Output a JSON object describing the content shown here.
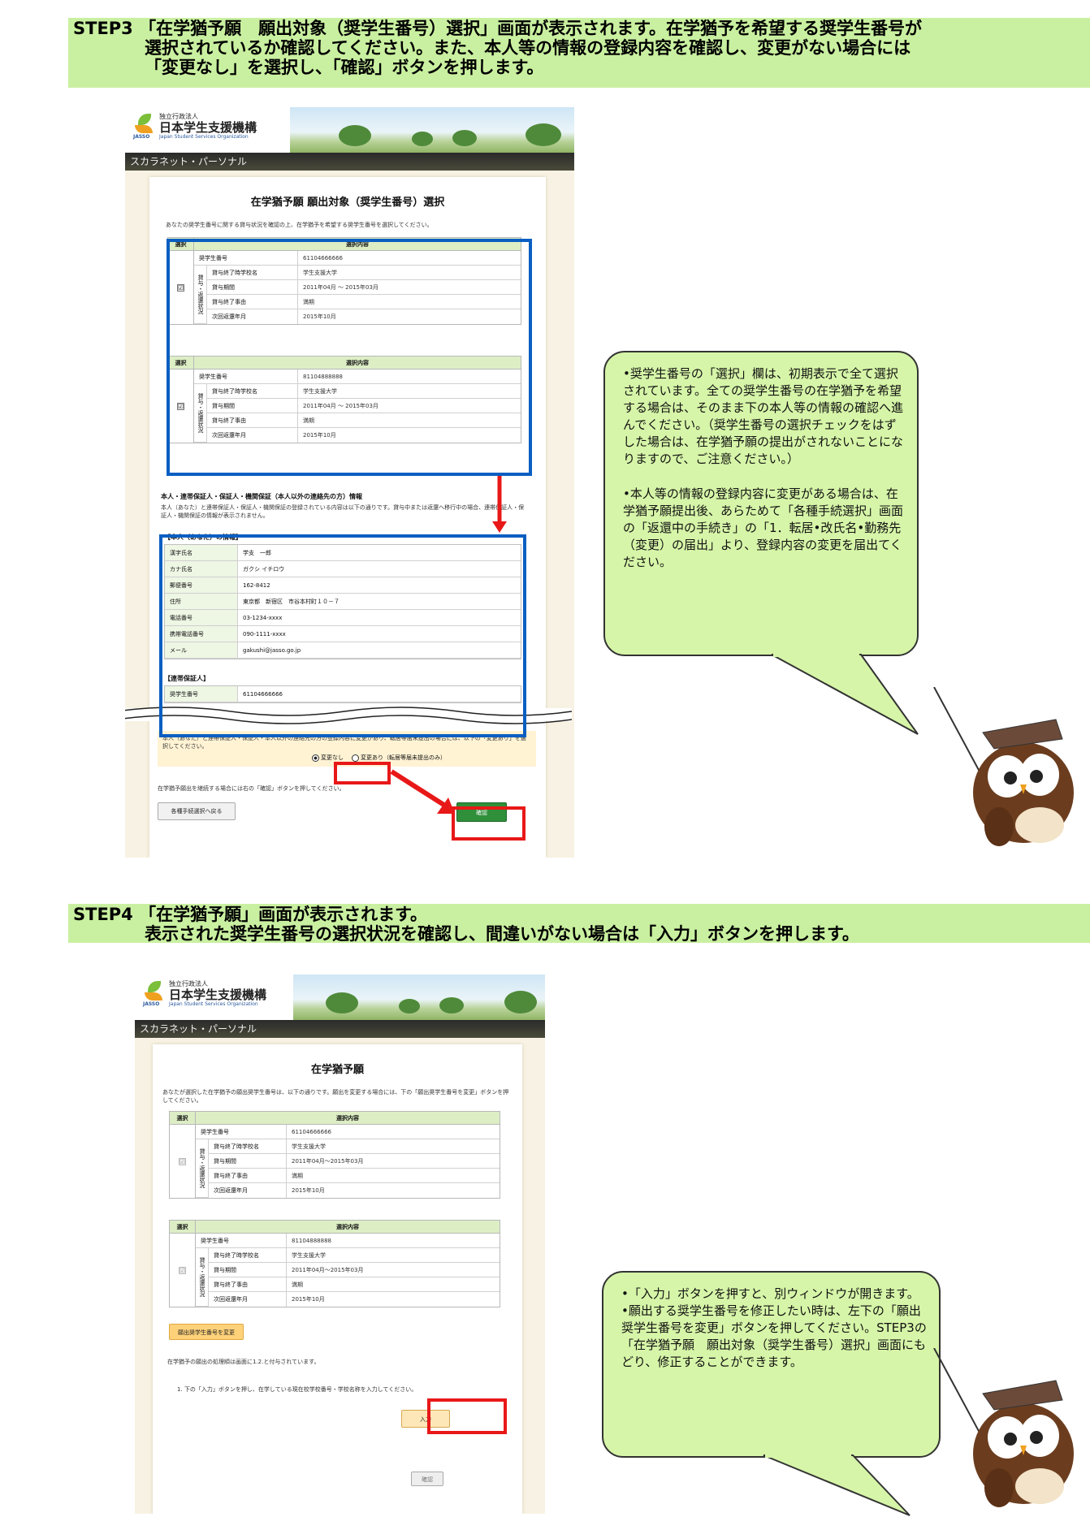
{
  "step3": {
    "header_line1": "STEP3 「在学猶予願　願出対象（奨学生番号）選択」画面が表示されます。在学猶予を希望する奨学生番号が",
    "header_line2": "選択されているか確認してください。また、本人等の情報の登録内容を確認し、変更がない場合には",
    "header_line3": "「変更なし」を選択し、「確認」ボタンを押します。",
    "screen": {
      "org_small": "独立行政法人",
      "org_name": "日本学生支援機構",
      "org_en": "Japan Student Services Organization",
      "jasso_label": "JASSO",
      "nav": "スカラネット・パーソナル",
      "title": "在学猶予願 願出対象（奨学生番号）選択",
      "intro": "あなたの奨学生番号に関する貸与状況を確認の上、在学猶予を希望する奨学生番号を選択してください。",
      "col_select": "選択",
      "col_content": "選択内容",
      "label_number": "奨学生番号",
      "group_label": "貸与・返還状況",
      "label_school": "貸与終了時学校名",
      "label_period": "貸与期間",
      "label_reason": "貸与終了事由",
      "label_next": "次回返還年月",
      "records": [
        {
          "number": "61104666666",
          "school": "学生支援大学",
          "period": "2011年04月 ～ 2015年03月",
          "reason": "満期",
          "next": "2015年10月",
          "checked": "☑"
        },
        {
          "number": "81104888888",
          "school": "学生支援大学",
          "period": "2011年04月 ～ 2015年03月",
          "reason": "満期",
          "next": "2015年10月",
          "checked": "☑"
        }
      ],
      "info_heading": "本人・連帯保証人・保証人・機関保証（本人以外の連絡先の方）情報",
      "info_note": "本人（あなた）と連帯保証人・保証人・機関保証の登録されている内容は以下の通りです。貸与中または返還へ移行中の場合、連帯保証人・保証人・機関保証の情報が表示されません。",
      "self_heading": "【本人（あなた）の情報】",
      "self_rows": [
        {
          "label": "漢字氏名",
          "value": "学支　一郎"
        },
        {
          "label": "カナ氏名",
          "value": "ガクシ イチロウ"
        },
        {
          "label": "郵便番号",
          "value": "162-8412"
        },
        {
          "label": "住所",
          "value": "東京都　新宿区　市谷本村町１０－７"
        },
        {
          "label": "電話番号",
          "value": "03-1234-xxxx"
        },
        {
          "label": "携帯電話番号",
          "value": "090-1111-xxxx"
        },
        {
          "label": "メール",
          "value": "gakushi@jasso.go.jp"
        }
      ],
      "guarantor_heading": "【連帯保証人】",
      "guarantor_label": "奨学生番号",
      "guarantor_value": "61104666666",
      "change_note": "本人（あなた）と連帯保証人・保証人・本人以外の連絡先の方の登録内容に変更があり、転居等届未提出の場合には、以下の「変更あり」を選択してください。",
      "radio_no_change": "変更なし",
      "radio_change": "変更あり（転居等届未提出のみ）",
      "confirm_note": "在学猶予願出を継続する場合には右の「確認」ボタンを押してください。",
      "back_button": "各種手続選択へ戻る",
      "confirm_button": "確認"
    },
    "callout_p1": "•奨学生番号の「選択」欄は、初期表示で全て選択されています。全ての奨学生番号の在学猶予を希望する場合は、そのまま下の本人等の情報の確認へ進んでください。（奨学生番号の選択チェックをはずした場合は、在学猶予願の提出がされないことになりますので、ご注意ください。）",
    "callout_p2": "•本人等の情報の登録内容に変更がある場合は、在学猶予願提出後、あらためて「各種手続選択」画面の「返還中の手続き」の「1．転居•改氏名•勤務先（変更）の届出」より、登録内容の変更を届出てください。"
  },
  "step4": {
    "header_line1": "STEP4 「在学猶予願」画面が表示されます。",
    "header_line2": "表示された奨学生番号の選択状況を確認し、間違いがない場合は「入力」ボタンを押します。",
    "screen": {
      "org_small": "独立行政法人",
      "org_name": "日本学生支援機構",
      "org_en": "Japan Student Services Organization",
      "jasso_label": "JASSO",
      "nav": "スカラネット・パーソナル",
      "title": "在学猶予願",
      "intro": "あなたが選択した在学猶予の願出奨学生番号は、以下の通りです。願出を変更する場合には、下の「願出奨学生番号を変更」ボタンを押してください。",
      "col_select": "選択",
      "col_content": "選択内容",
      "label_number": "奨学生番号",
      "group_label": "貸与・返還状況",
      "label_school": "貸与終了時学校名",
      "label_period": "貸与期間",
      "label_reason": "貸与終了事由",
      "label_next": "次回返還年月",
      "records": [
        {
          "number": "61104666666",
          "school": "学生支援大学",
          "period": "2011年04月～2015年03月",
          "reason": "満期",
          "next": "2015年10月",
          "checked": "☑"
        },
        {
          "number": "81104888888",
          "school": "学生支援大学",
          "period": "2011年04月～2015年03月",
          "reason": "満期",
          "next": "2015年10月",
          "checked": "☑"
        }
      ],
      "change_button": "願出奨学生番号を変更",
      "process_note": "在学猶予の願出の処理順は画面に1.2.と付与されています。",
      "step_note": "1. 下の「入力」ボタンを押し、在学している現在校学校番号・学校名称を入力してください。",
      "input_button": "入力",
      "confirm_button": "確認"
    },
    "callout_p1": "•「入力」ボタンを押すと、別ウィンドウが開きます。",
    "callout_p2": "•願出する奨学生番号を修正したい時は、左下の「願出奨学生番号を変更」ボタンを押してください。STEP3の「在学猶予願　願出対象（奨学生番号）選択」画面にもどり、修正することができます。"
  },
  "colors": {
    "header_bg": "#c9f0a0",
    "callout_bg": "#d6f5a8",
    "highlight_blue": "#0a5ec2",
    "highlight_red": "#e81818",
    "confirm_green": "#2f8f3a"
  }
}
